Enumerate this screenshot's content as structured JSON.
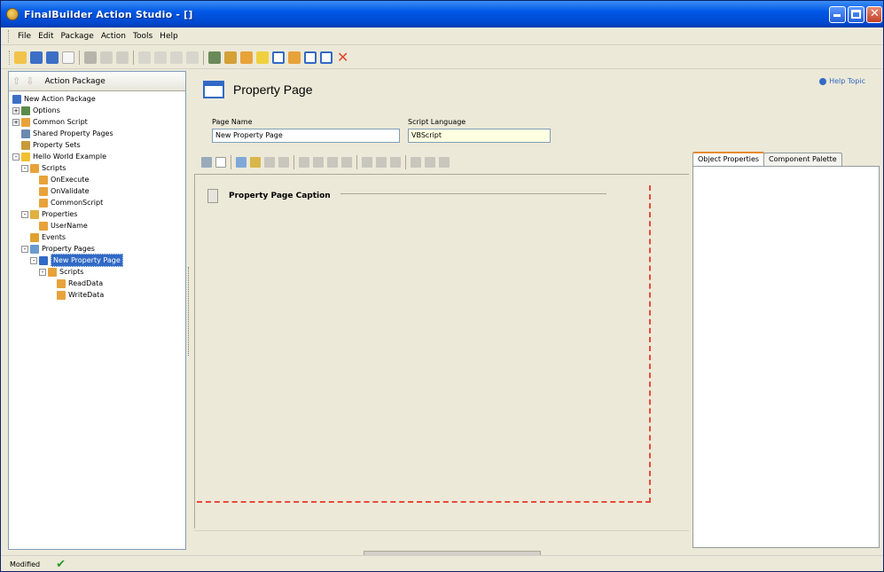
{
  "window": {
    "title": "FinalBuilder Action Studio - []"
  },
  "menu": [
    "File",
    "Edit",
    "Package",
    "Action",
    "Tools",
    "Help"
  ],
  "left_panel": {
    "header": "Action Package",
    "tree": [
      {
        "label": "New Action Package",
        "indent": 0,
        "icon": "package-icon",
        "expander": ""
      },
      {
        "label": "Options",
        "indent": 0,
        "icon": "options-icon",
        "expander": "+"
      },
      {
        "label": "Common Script",
        "indent": 0,
        "icon": "script-icon",
        "expander": "+"
      },
      {
        "label": "Shared Property Pages",
        "indent": 1,
        "icon": "shared-pages-icon",
        "expander": ""
      },
      {
        "label": "Property Sets",
        "indent": 1,
        "icon": "property-sets-icon",
        "expander": ""
      },
      {
        "label": "Hello World Example",
        "indent": 0,
        "icon": "action-icon",
        "expander": "-"
      },
      {
        "label": "Scripts",
        "indent": 1,
        "icon": "scripts-icon",
        "expander": "-"
      },
      {
        "label": "OnExecute",
        "indent": 3,
        "icon": "script-icon",
        "expander": ""
      },
      {
        "label": "OnValidate",
        "indent": 3,
        "icon": "script-icon",
        "expander": ""
      },
      {
        "label": "CommonScript",
        "indent": 3,
        "icon": "script-icon",
        "expander": ""
      },
      {
        "label": "Properties",
        "indent": 1,
        "icon": "properties-icon",
        "expander": "-"
      },
      {
        "label": "UserName",
        "indent": 3,
        "icon": "property-icon",
        "expander": ""
      },
      {
        "label": "Events",
        "indent": 2,
        "icon": "events-icon",
        "expander": ""
      },
      {
        "label": "Property Pages",
        "indent": 1,
        "icon": "property-pages-icon",
        "expander": "-"
      },
      {
        "label": "New Property Page",
        "indent": 2,
        "icon": "page-icon",
        "expander": "-",
        "selected": true
      },
      {
        "label": "Scripts",
        "indent": 3,
        "icon": "scripts-icon",
        "expander": "-"
      },
      {
        "label": "ReadData",
        "indent": 5,
        "icon": "script-icon",
        "expander": ""
      },
      {
        "label": "WriteData",
        "indent": 5,
        "icon": "script-icon",
        "expander": ""
      }
    ]
  },
  "editor": {
    "title": "Property Page",
    "help_topic": "Help Topic",
    "page_name_label": "Page Name",
    "page_name_value": "New Property Page",
    "script_language_label": "Script Language",
    "script_language_value": "VBScript",
    "caption": "Property Page Caption"
  },
  "right_panel": {
    "tabs": [
      "Object Properties",
      "Component Palette"
    ],
    "active_tab": "Object Properties"
  },
  "status": {
    "text": "Modified"
  },
  "colors": {
    "title_bar": "#0058e6",
    "selection": "#316ac5",
    "guide_dash": "#e84a3a",
    "tab_accent": "#e68b2c"
  }
}
